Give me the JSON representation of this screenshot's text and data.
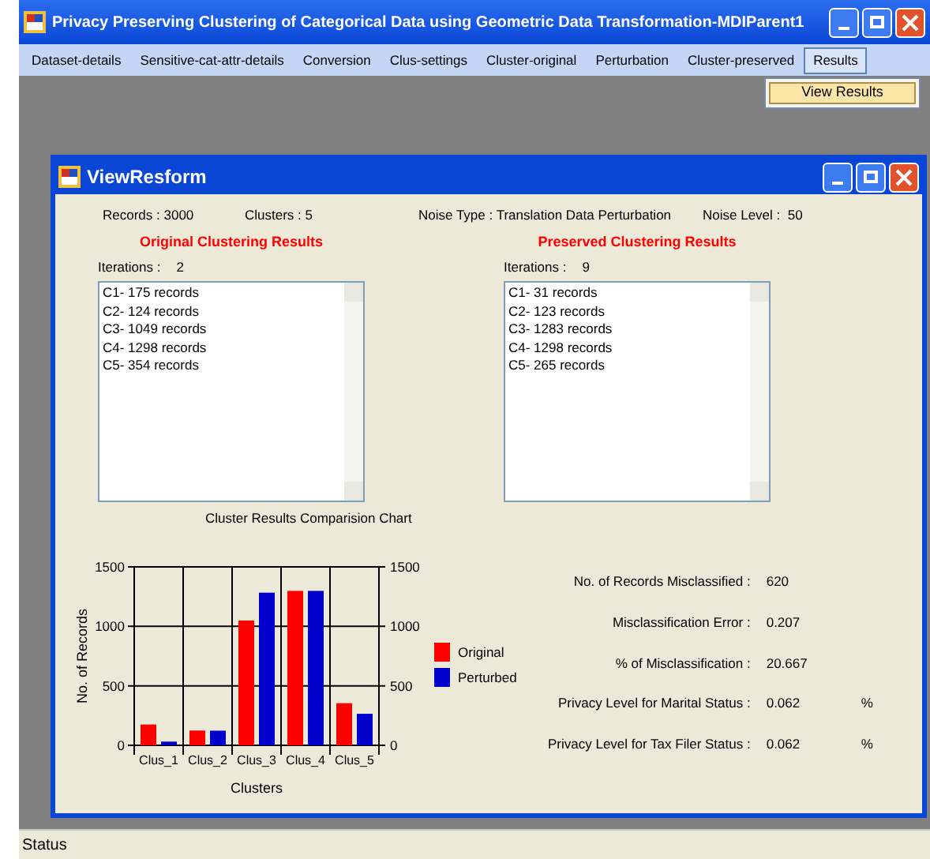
{
  "window": {
    "title": "Privacy Preserving Clustering of Categorical Data using Geometric Data Transformation-MDIParent1"
  },
  "menu": [
    {
      "label": "Dataset-details",
      "selected": false
    },
    {
      "label": "Sensitive-cat-attr-details",
      "selected": false
    },
    {
      "label": "Conversion",
      "selected": false
    },
    {
      "label": "Clus-settings",
      "selected": false
    },
    {
      "label": "Cluster-original",
      "selected": false
    },
    {
      "label": "Perturbation",
      "selected": false
    },
    {
      "label": "Cluster-preserved",
      "selected": false
    },
    {
      "label": "Results",
      "selected": true
    }
  ],
  "dropdown": {
    "items": [
      {
        "label": "View Results",
        "selected": true
      }
    ]
  },
  "child_window": {
    "title": "ViewResform",
    "summary": [
      {
        "label": "Records :",
        "value": "3000"
      },
      {
        "label": "Clusters :",
        "value": "5"
      },
      {
        "label": "Noise Type :",
        "value": "Translation Data Perturbation"
      },
      {
        "label": "Noise Level :",
        "value": "50"
      }
    ],
    "results": [
      {
        "heading": "Original Clustering Results",
        "iterations_label": "Iterations :",
        "iterations": "2",
        "lines": [
          "C1- 175 records",
          "C2- 124 records",
          "C3- 1049 records",
          "C4- 1298 records",
          "C5- 354 records"
        ]
      },
      {
        "heading": "Preserved Clustering Results",
        "iterations_label": "Iterations :",
        "iterations": "9",
        "lines": [
          "C1- 31 records",
          "C2- 123 records",
          "C3- 1283 records",
          "C4- 1298 records",
          "C5- 265 records"
        ]
      }
    ],
    "chart_data": {
      "type": "bar",
      "title": "Cluster Results Comparision Chart",
      "xlabel": "Clusters",
      "ylabel": "No. of Records",
      "categories": [
        "Clus_1",
        "Clus_2",
        "Clus_3",
        "Clus_4",
        "Clus_5"
      ],
      "series": [
        {
          "name": "Original",
          "color": "#ff0000",
          "values": [
            175,
            124,
            1049,
            1298,
            354
          ]
        },
        {
          "name": "Perturbed",
          "color": "#0000cc",
          "values": [
            31,
            123,
            1283,
            1298,
            265
          ]
        }
      ],
      "ylim": [
        0,
        1500
      ],
      "yticks": [
        0,
        500,
        1000,
        1500
      ],
      "y2ticks": [
        0,
        500,
        1000,
        1500
      ],
      "y2lim": [
        0,
        1500
      ]
    },
    "stats": [
      {
        "label": "No. of Records Misclassified :",
        "value": "620"
      },
      {
        "label": "Misclassification Error :",
        "value": "0.207"
      },
      {
        "label": "% of Misclassification :",
        "value": "20.667"
      },
      {
        "label": "Privacy Level for Marital Status :",
        "value": "0.062",
        "unit": "%"
      },
      {
        "label": "Privacy Level for Tax Filer Status :",
        "value": "0.062",
        "unit": "%"
      }
    ]
  },
  "status_bar": {
    "text": "Status"
  }
}
